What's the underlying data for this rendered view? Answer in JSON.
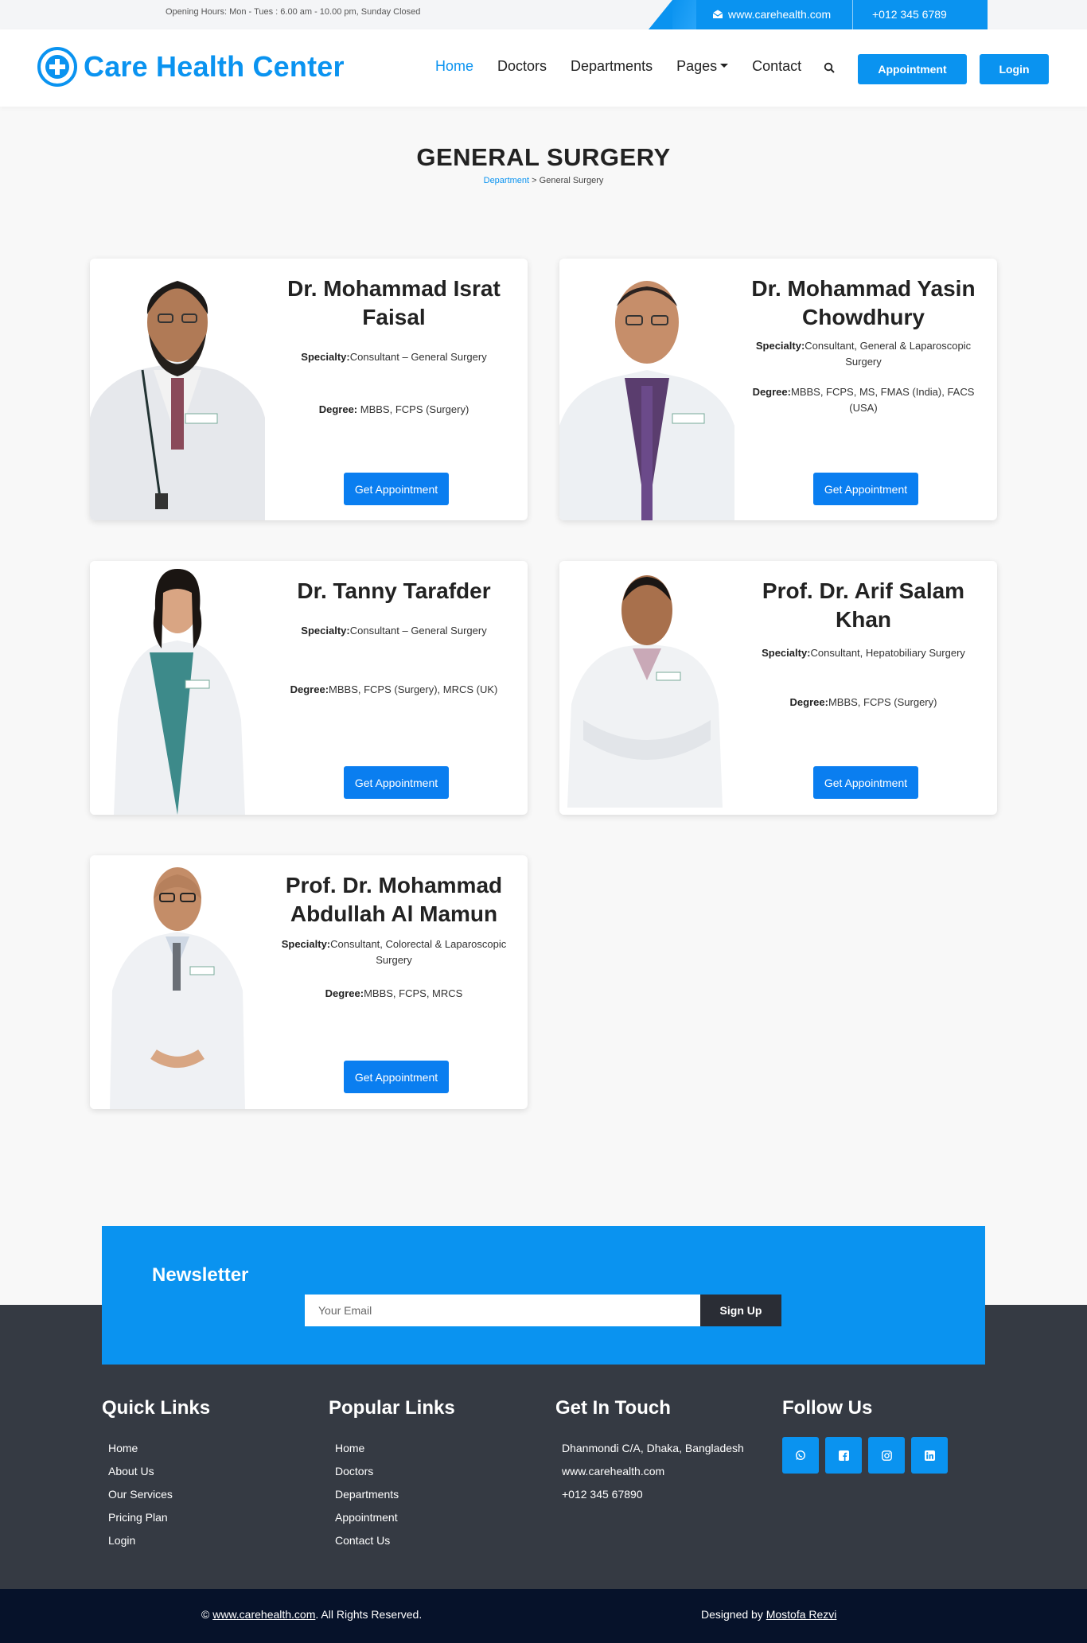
{
  "topbar": {
    "hours": "Opening Hours: Mon - Tues : 6.00 am - 10.00 pm, Sunday Closed",
    "website": "www.carehealth.com",
    "phone": "+012 345 6789"
  },
  "header": {
    "brand": "Care Health Center",
    "nav": {
      "home": "Home",
      "doctors": "Doctors",
      "departments": "Departments",
      "pages": "Pages",
      "contact": "Contact"
    },
    "appointment_label": "Appointment",
    "login_label": "Login"
  },
  "page": {
    "title": "GENERAL SURGERY",
    "breadcrumb_link": "Department",
    "breadcrumb_sep": " > ",
    "breadcrumb_current": "General Surgery"
  },
  "doctors": [
    {
      "name": "Dr. Mohammad Israt Faisal",
      "specialty_label": "Specialty:",
      "specialty": "Consultant – General Surgery",
      "degree_label": "Degree:",
      "degree": " MBBS, FCPS (Surgery)",
      "button": "Get Appointment"
    },
    {
      "name": "Dr. Mohammad Yasin Chowdhury",
      "specialty_label": "Specialty:",
      "specialty": "Consultant, General & Laparoscopic Surgery",
      "degree_label": "Degree:",
      "degree": "MBBS, FCPS, MS, FMAS (India), FACS (USA)",
      "button": "Get Appointment"
    },
    {
      "name": "Dr. Tanny Tarafder",
      "specialty_label": "Specialty:",
      "specialty": "Consultant – General Surgery",
      "degree_label": "Degree:",
      "degree": "MBBS, FCPS (Surgery), MRCS (UK)",
      "button": "Get Appointment"
    },
    {
      "name": "Prof. Dr. Arif Salam Khan",
      "specialty_label": "Specialty:",
      "specialty": "Consultant, Hepatobiliary Surgery",
      "degree_label": "Degree:",
      "degree": "MBBS, FCPS (Surgery)",
      "button": "Get Appointment"
    },
    {
      "name": "Prof. Dr. Mohammad Abdullah Al Mamun",
      "specialty_label": "Specialty:",
      "specialty": "Consultant, Colorectal & Laparoscopic Surgery",
      "degree_label": "Degree:",
      "degree": "MBBS, FCPS, MRCS",
      "button": "Get Appointment"
    }
  ],
  "newsletter": {
    "title": "Newsletter",
    "placeholder": "Your Email",
    "button": "Sign Up"
  },
  "footer": {
    "quick_links": {
      "title": "Quick Links",
      "items": [
        "Home",
        "About Us",
        "Our Services",
        "Pricing Plan",
        "Login"
      ]
    },
    "popular_links": {
      "title": "Popular Links",
      "items": [
        "Home",
        "Doctors",
        "Departments",
        "Appointment",
        "Contact Us"
      ]
    },
    "get_in_touch": {
      "title": "Get In Touch",
      "items": [
        "Dhanmondi C/A, Dhaka, Bangladesh",
        "www.carehealth.com",
        "+012 345 67890"
      ]
    },
    "follow_us": {
      "title": "Follow Us",
      "icons": [
        "whatsapp-icon",
        "facebook-icon",
        "instagram-icon",
        "linkedin-icon"
      ]
    }
  },
  "bottom": {
    "copy_prefix": "© ",
    "copy_site": "www.carehealth.com",
    "copy_suffix": ". All Rights Reserved.",
    "designed_prefix": "Designed by ",
    "designer": "Mostofa Rezvi"
  },
  "colors": {
    "primary": "#0a93f0",
    "footer_bg": "#353a43",
    "bottom_bg": "#06122a"
  }
}
